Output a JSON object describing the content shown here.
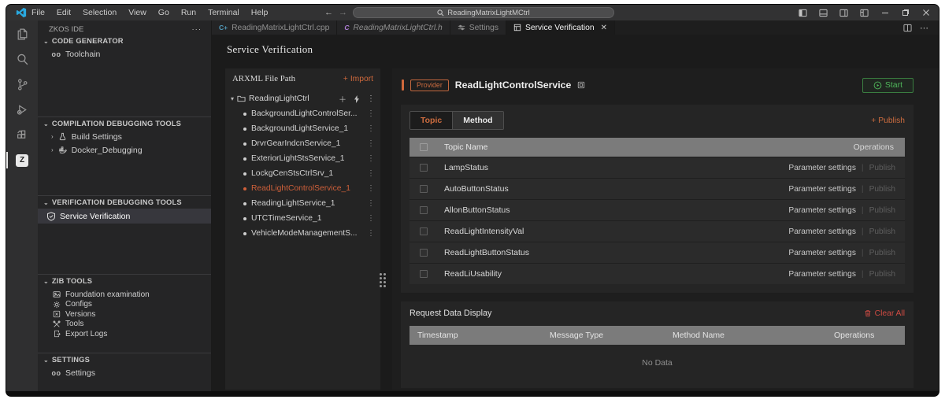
{
  "colors": {
    "accent_orange": "#d0693c",
    "start_green": "#4fb65a",
    "danger_red": "#cf4b43",
    "selected_tree": "#d0603a"
  },
  "title_bar": {
    "menus": [
      "File",
      "Edit",
      "Selection",
      "View",
      "Go",
      "Run",
      "Terminal",
      "Help"
    ],
    "search_value": "ReadingMatrixLightMCtrl"
  },
  "activity_bar": {
    "icons": [
      "explorer-icon",
      "search-icon",
      "source-control-icon",
      "run-debug-icon",
      "extensions-icon",
      "zkos-extension-icon"
    ]
  },
  "sidebar": {
    "title": "ZKOS IDE",
    "more": "···",
    "sections": [
      {
        "title": "CODE GENERATOR",
        "items": [
          {
            "label": "Toolchain",
            "icon": "toolchain-icon"
          }
        ]
      },
      {
        "title": "COMPILATION DEBUGGING TOOLS",
        "items": [
          {
            "label": "Build Settings",
            "icon": "beaker-icon"
          },
          {
            "label": "Docker_Debugging",
            "icon": "docker-icon"
          }
        ]
      },
      {
        "title": "VERIFICATION DEBUGGING TOOLS",
        "items": [
          {
            "label": "Service Verification",
            "icon": "shield-check-icon",
            "selected": true
          }
        ]
      },
      {
        "title": "ZIB TOOLS",
        "items": [
          {
            "label": "Foundation examination",
            "icon": "image-icon"
          },
          {
            "label": "Configs",
            "icon": "gear-icon"
          },
          {
            "label": "Versions",
            "icon": "versions-icon"
          },
          {
            "label": "Tools",
            "icon": "tools-icon"
          },
          {
            "label": "Export Logs",
            "icon": "export-logs-icon"
          }
        ]
      },
      {
        "title": "SETTINGS",
        "items": [
          {
            "label": "Settings",
            "icon": "settings-icon"
          }
        ]
      }
    ]
  },
  "tabs": [
    {
      "label": "ReadingMatrixLightCtrl.cpp",
      "icon_text": "C+",
      "active": false
    },
    {
      "label": "ReadingMatrixLightCtrl.h",
      "icon_text": "C",
      "preview": true,
      "active": false
    },
    {
      "label": "Settings",
      "active": false
    },
    {
      "label": "Service Verification",
      "active": true
    }
  ],
  "main": {
    "heading": "Service Verification",
    "arxml": {
      "header": "ARXML File Path",
      "import_plus": "+",
      "import_label": "Import",
      "root": "ReadingLightCtrl",
      "items": [
        "BackgroundLightControlSer...",
        "BackgroundLightService_1",
        "DrvrGearIndcnService_1",
        "ExteriorLightStsService_1",
        "LockgCenStsCtrlSrv_1",
        "ReadLightControlService_1",
        "ReadingLightService_1",
        "UTCTimeService_1",
        "VehicleModeManagementS..."
      ],
      "selected_item": "ReadLightControlService_1"
    },
    "service": {
      "badge": "Provider",
      "name": "ReadLightControlService",
      "start_label": "Start",
      "tab_topic": "Topic",
      "tab_method": "Method",
      "publish_plus": "+",
      "publish_label": "Publish",
      "columns": {
        "name": "Topic Name",
        "operations": "Operations"
      },
      "rows": [
        "LampStatus",
        "AutoButtonStatus",
        "AllonButtonStatus",
        "ReadLightIntensityVal",
        "ReadLightButtonStatus",
        "ReadLiUsability"
      ],
      "actions": {
        "params": "Parameter settings",
        "divider": "|",
        "publish": "Publish"
      }
    },
    "request": {
      "title": "Request Data Display",
      "clear_label": "Clear All",
      "columns": [
        "Timestamp",
        "Message Type",
        "Method Name",
        "Operations"
      ],
      "empty": "No Data"
    }
  }
}
